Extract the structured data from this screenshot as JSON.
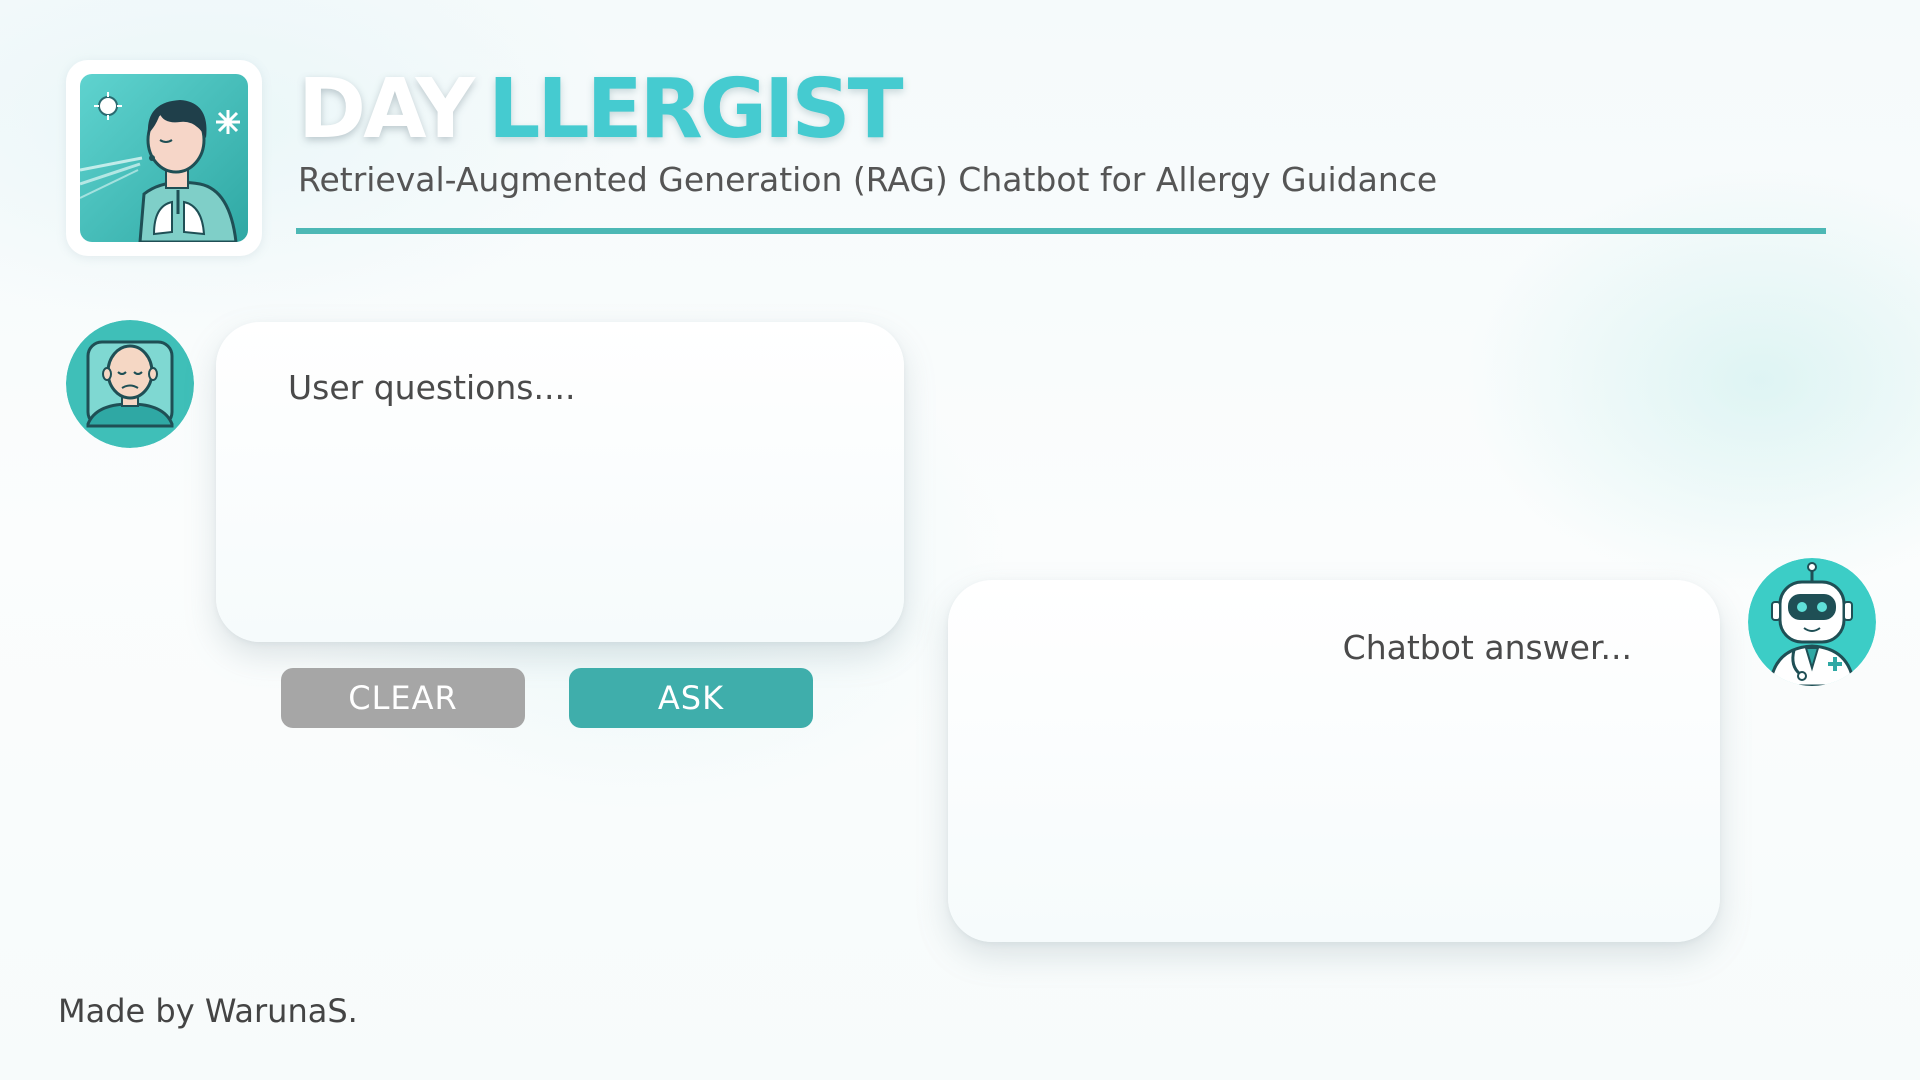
{
  "header": {
    "title_part1": "DAY",
    "title_part2": "LLERGIST",
    "subtitle": "Retrieval-Augmented Generation (RAG) Chatbot for Allergy Guidance"
  },
  "chat": {
    "user_placeholder": "User questions....",
    "bot_placeholder": "Chatbot answer..."
  },
  "buttons": {
    "clear_label": "CLEAR",
    "ask_label": "ASK"
  },
  "footer": {
    "credit": "Made by WarunaS."
  },
  "colors": {
    "accent": "#45cbd0",
    "rule": "#4db8b5",
    "ask_button": "#3faeab",
    "clear_button": "#a6a6a6"
  },
  "icons": {
    "logo": "allergy-person-lungs-icon",
    "user_avatar": "sick-user-avatar-icon",
    "bot_avatar": "doctor-robot-avatar-icon"
  }
}
